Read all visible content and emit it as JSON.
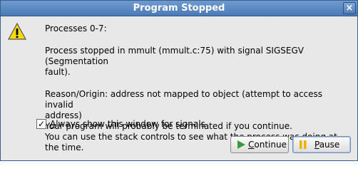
{
  "window": {
    "title": "Program Stopped",
    "close_label": "×"
  },
  "icons": {
    "message": "warning-icon",
    "close": "close-icon",
    "continue": "play-icon",
    "pause": "pause-icon",
    "checkbox": "checkmark-icon"
  },
  "message": {
    "line1": "Processes 0-7:",
    "line2": "Process stopped in mmult (mmult.c:75) with signal SIGSEGV (Segmentation",
    "line3": "fault).",
    "line4": "Reason/Origin: address not mapped to object (attempt to access invalid",
    "line5": "address)",
    "line6": "Your program will probably be terminated if you continue.",
    "line7": "You can use the stack controls to see what the process was doing at the time."
  },
  "checkbox": {
    "checked": true,
    "mark": "✓",
    "label_first_letter": "A",
    "label_rest": "lways show this window for signals"
  },
  "buttons": {
    "continue_first_letter": "C",
    "continue_rest": "ontinue",
    "pause_first_letter": "P",
    "pause_rest": "ause"
  },
  "colors": {
    "titlebar": "#4a79b4",
    "window_bg": "#e8e8e8",
    "warning_yellow": "#f5d90a",
    "play_green": "#3a9a3a",
    "pause_yellow": "#e8b400"
  }
}
